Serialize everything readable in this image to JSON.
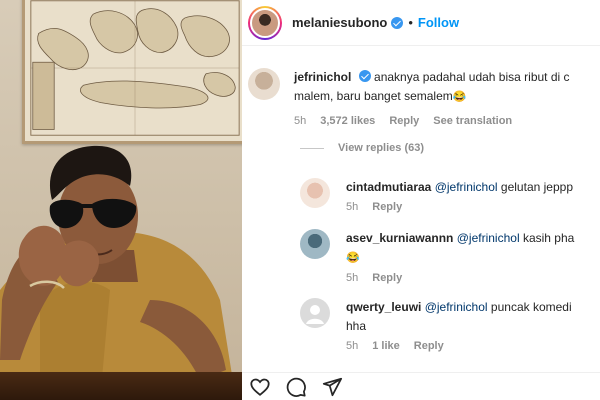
{
  "post": {
    "username": "melaniesubono",
    "separator": "•",
    "follow_label": "Follow"
  },
  "comments": [
    {
      "username": "jefrinichol",
      "verified": true,
      "text_line1": "anaknya padahal udah bisa ribut di c",
      "text_line2": "malem, baru banget semalem",
      "emoji": "😂",
      "time": "5h",
      "likes": "3,572 likes",
      "reply_label": "Reply",
      "translate_label": "See translation"
    }
  ],
  "view_replies": "View replies (63)",
  "replies": [
    {
      "username": "cintadmutiaraa",
      "mention": "@jefrinichol",
      "text_line1": "gelutan jeppp",
      "time": "5h",
      "reply_label": "Reply"
    },
    {
      "username": "asev_kurniawannn",
      "mention": "@jefrinichol",
      "text_line1": "kasih pha",
      "emoji": "😂",
      "time": "5h",
      "reply_label": "Reply"
    },
    {
      "username": "qwerty_leuwi",
      "mention": "@jefrinichol",
      "text_line1": "puncak komedi",
      "text_line2": "hha",
      "time": "5h",
      "likes": "1 like",
      "reply_label": "Reply"
    }
  ],
  "icons": {
    "like": "heart-icon",
    "comment": "comment-icon",
    "share": "send-icon",
    "verified": "verified-badge-icon"
  },
  "colors": {
    "link_blue": "#0095f6",
    "mention_blue": "#00376b",
    "meta_gray": "#8e8e8e",
    "verified_blue": "#3897f0"
  }
}
